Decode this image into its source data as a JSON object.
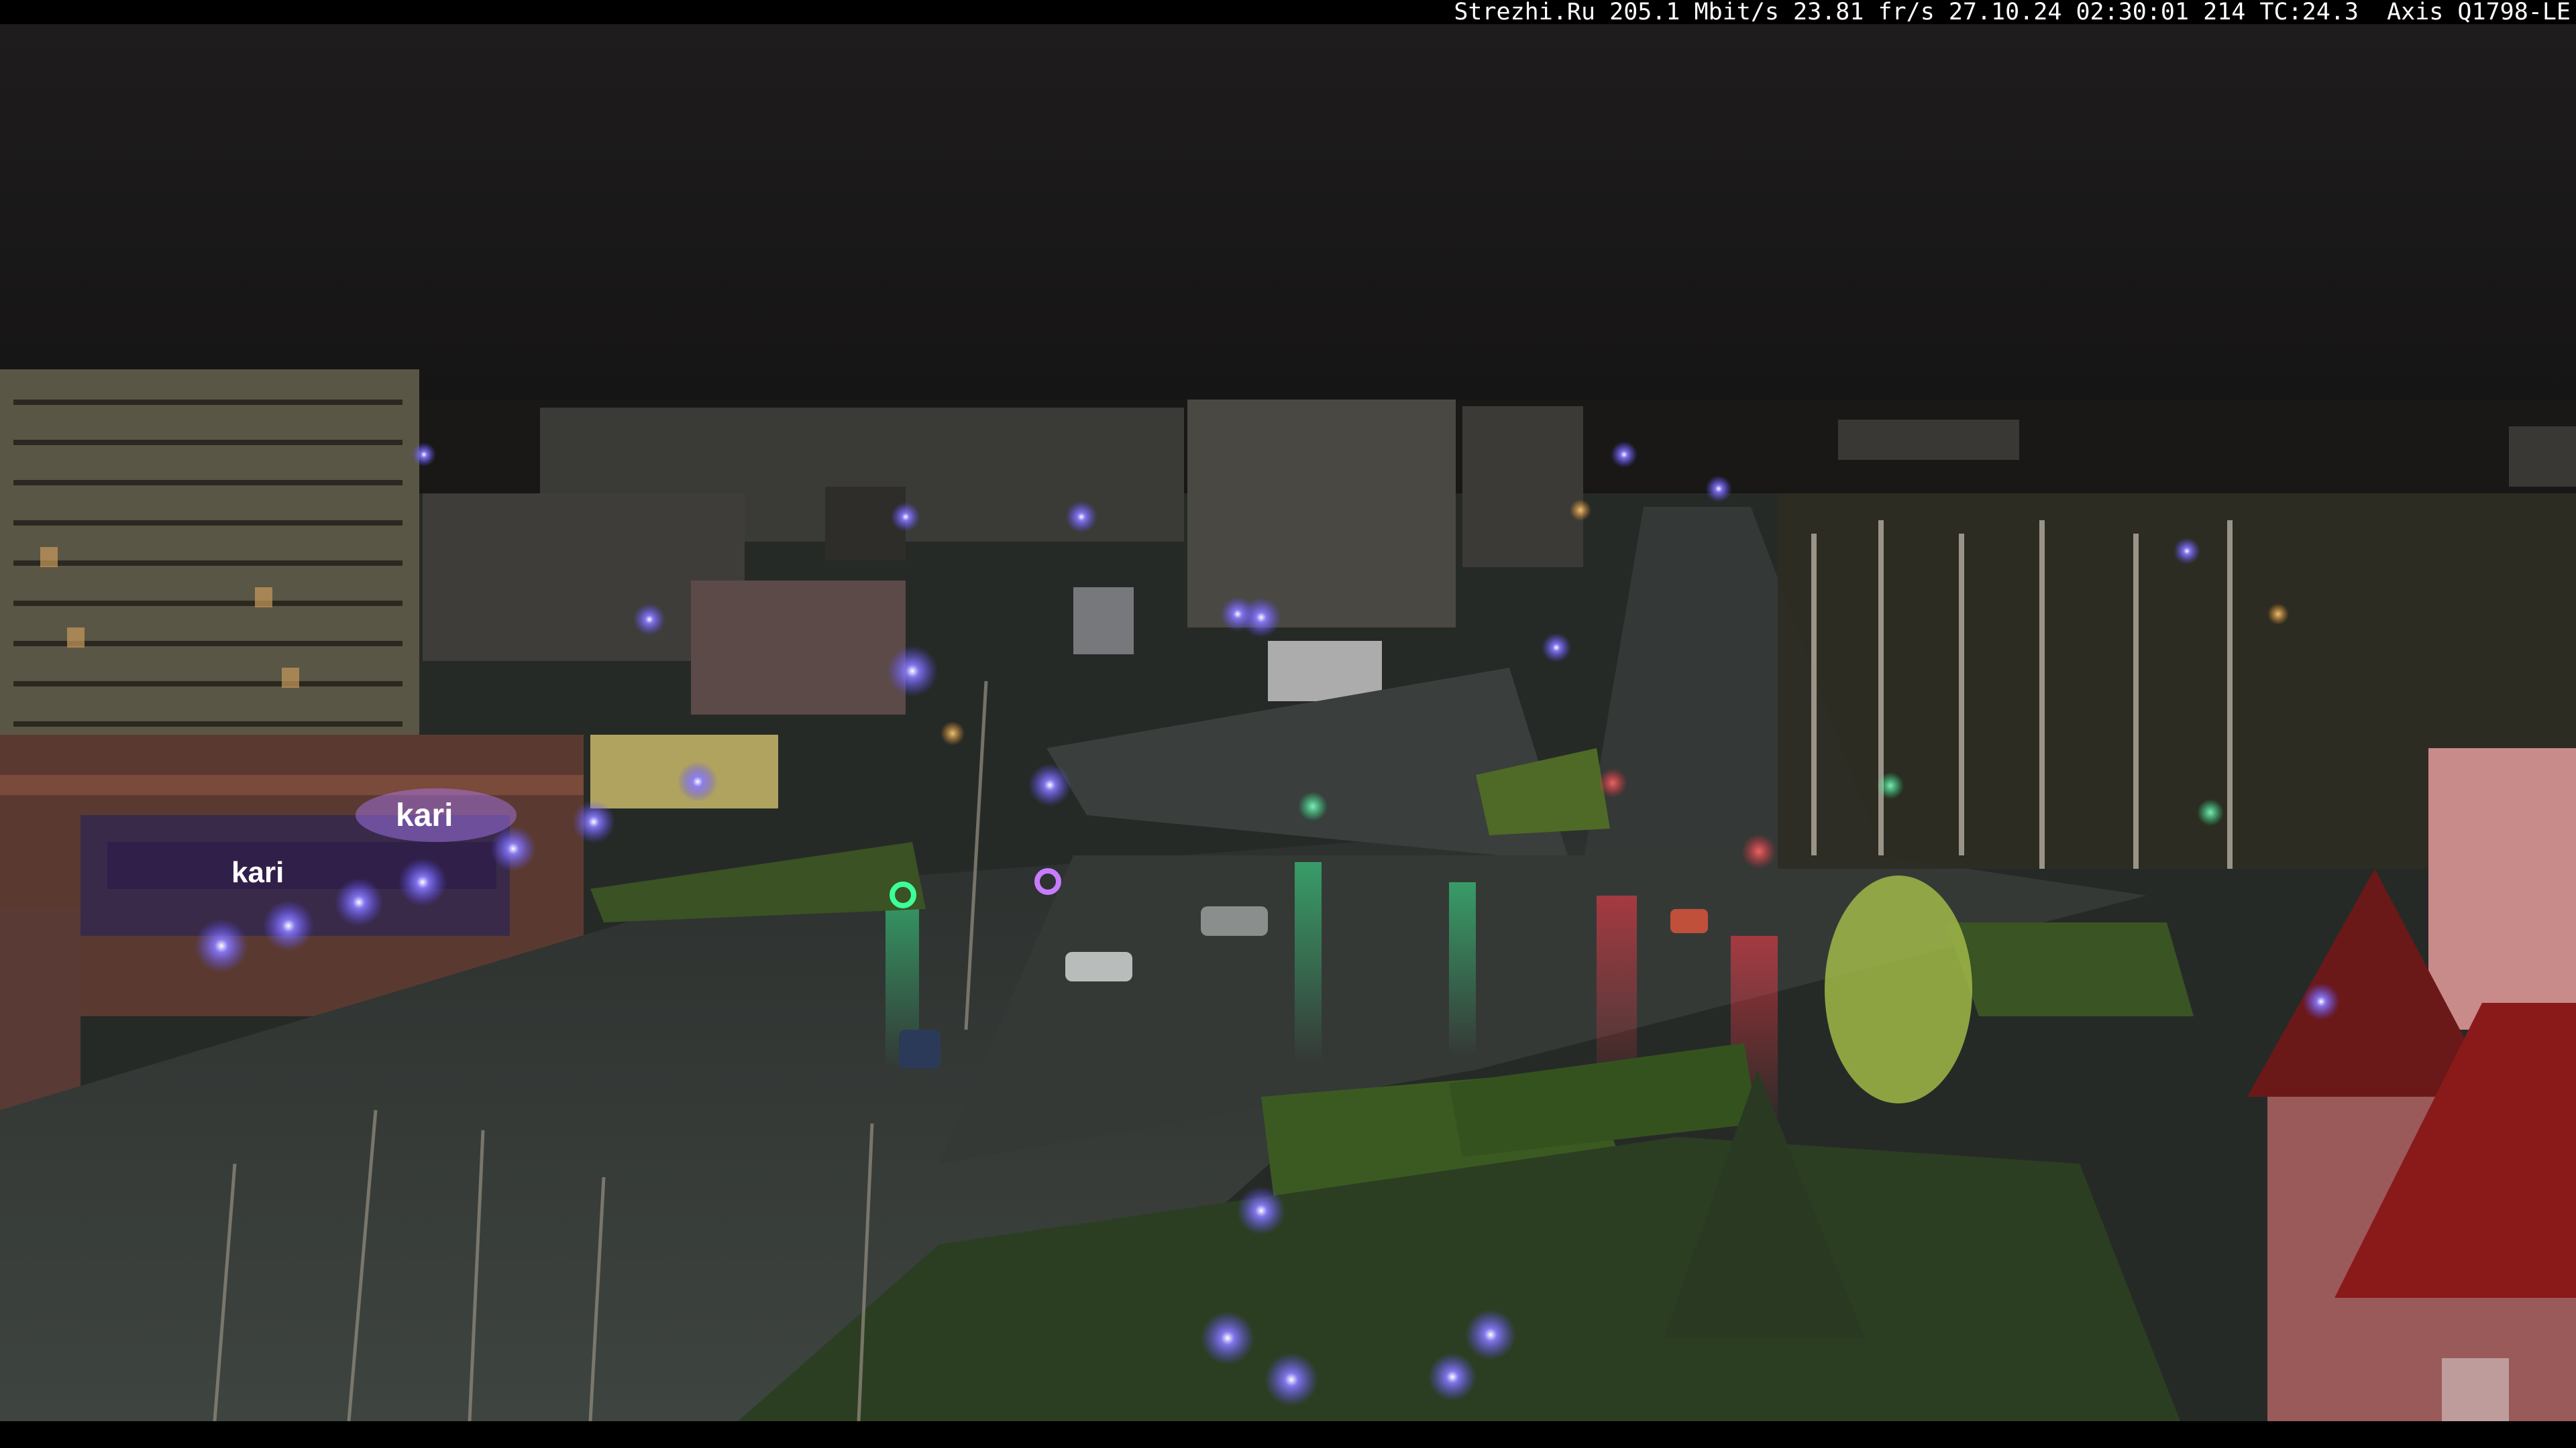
{
  "overlay": {
    "text": "Strezhi.Ru 205.1 Mbit/s 23.81 fr/s 27.10.24 02:30:01 214 TC:24.3  Axis Q1798-LE"
  },
  "colors": {
    "sky": "#1c1a1a",
    "street_light": "#7b6bff",
    "shop_sign": "#b07cff",
    "traffic_red": "#ff3a4a",
    "traffic_green": "#3cff9a",
    "grass": "#3c5a24",
    "asphalt": "#3a3f3c"
  },
  "scene": {
    "shop_sign_text": "kari",
    "shop_sign_text_2": "kari"
  }
}
